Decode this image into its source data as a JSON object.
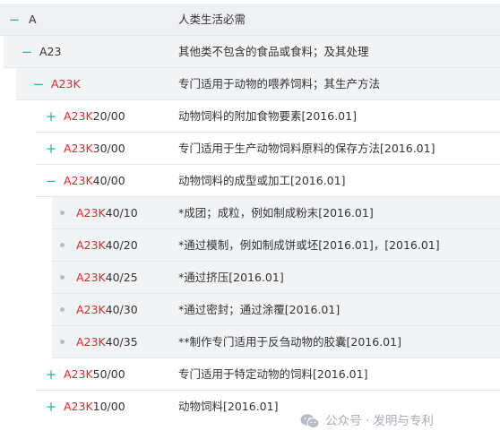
{
  "colors": {
    "class_code": "#e3262a",
    "toggle": "#27b3a8",
    "text": "#333333",
    "row_shade": "#f2f3f5"
  },
  "rows": [
    {
      "toggle": "−",
      "prefix": "A",
      "cls": "",
      "suffix": "",
      "desc": "人类生活必需"
    },
    {
      "toggle": "−",
      "prefix": "A23",
      "cls": "",
      "suffix": "",
      "desc": "其他类不包含的食品或食料；及其处理"
    },
    {
      "toggle": "−",
      "prefix": "",
      "cls": "A23K",
      "suffix": "",
      "desc": "专门适用于动物的喂养饲料；其生产方法"
    },
    {
      "toggle": "+",
      "prefix": "",
      "cls": "A23K",
      "suffix": "20/00",
      "desc": "动物饲料的附加食物要素[2016.01]"
    },
    {
      "toggle": "+",
      "prefix": "",
      "cls": "A23K",
      "suffix": "30/00",
      "desc": "专门适用于生产动物饲料原料的保存方法[2016.01]"
    },
    {
      "toggle": "−",
      "prefix": "",
      "cls": "A23K",
      "suffix": "40/00",
      "desc": "动物饲料的成型或加工[2016.01]"
    },
    {
      "toggle": "",
      "prefix": "",
      "cls": "A23K",
      "suffix": "40/10",
      "desc": "*成团；成粒，例如制成粉末[2016.01]"
    },
    {
      "toggle": "",
      "prefix": "",
      "cls": "A23K",
      "suffix": "40/20",
      "desc": "*通过模制，例如制成饼或坯[2016.01]，[2016.01]"
    },
    {
      "toggle": "",
      "prefix": "",
      "cls": "A23K",
      "suffix": "40/25",
      "desc": "*通过挤压[2016.01]"
    },
    {
      "toggle": "",
      "prefix": "",
      "cls": "A23K",
      "suffix": "40/30",
      "desc": "*通过密封；通过涂覆[2016.01]"
    },
    {
      "toggle": "",
      "prefix": "",
      "cls": "A23K",
      "suffix": "40/35",
      "desc": "**制作专门适用于反刍动物的胶囊[2016.01]"
    },
    {
      "toggle": "+",
      "prefix": "",
      "cls": "A23K",
      "suffix": "50/00",
      "desc": "专门适用于特定动物的饲料[2016.01]"
    },
    {
      "toggle": "+",
      "prefix": "",
      "cls": "A23K",
      "suffix": "10/00",
      "desc": "动物饲料[2016.01]"
    }
  ],
  "watermark": {
    "icon": "wechat-icon",
    "text": "公众号 · 发明与专利"
  }
}
